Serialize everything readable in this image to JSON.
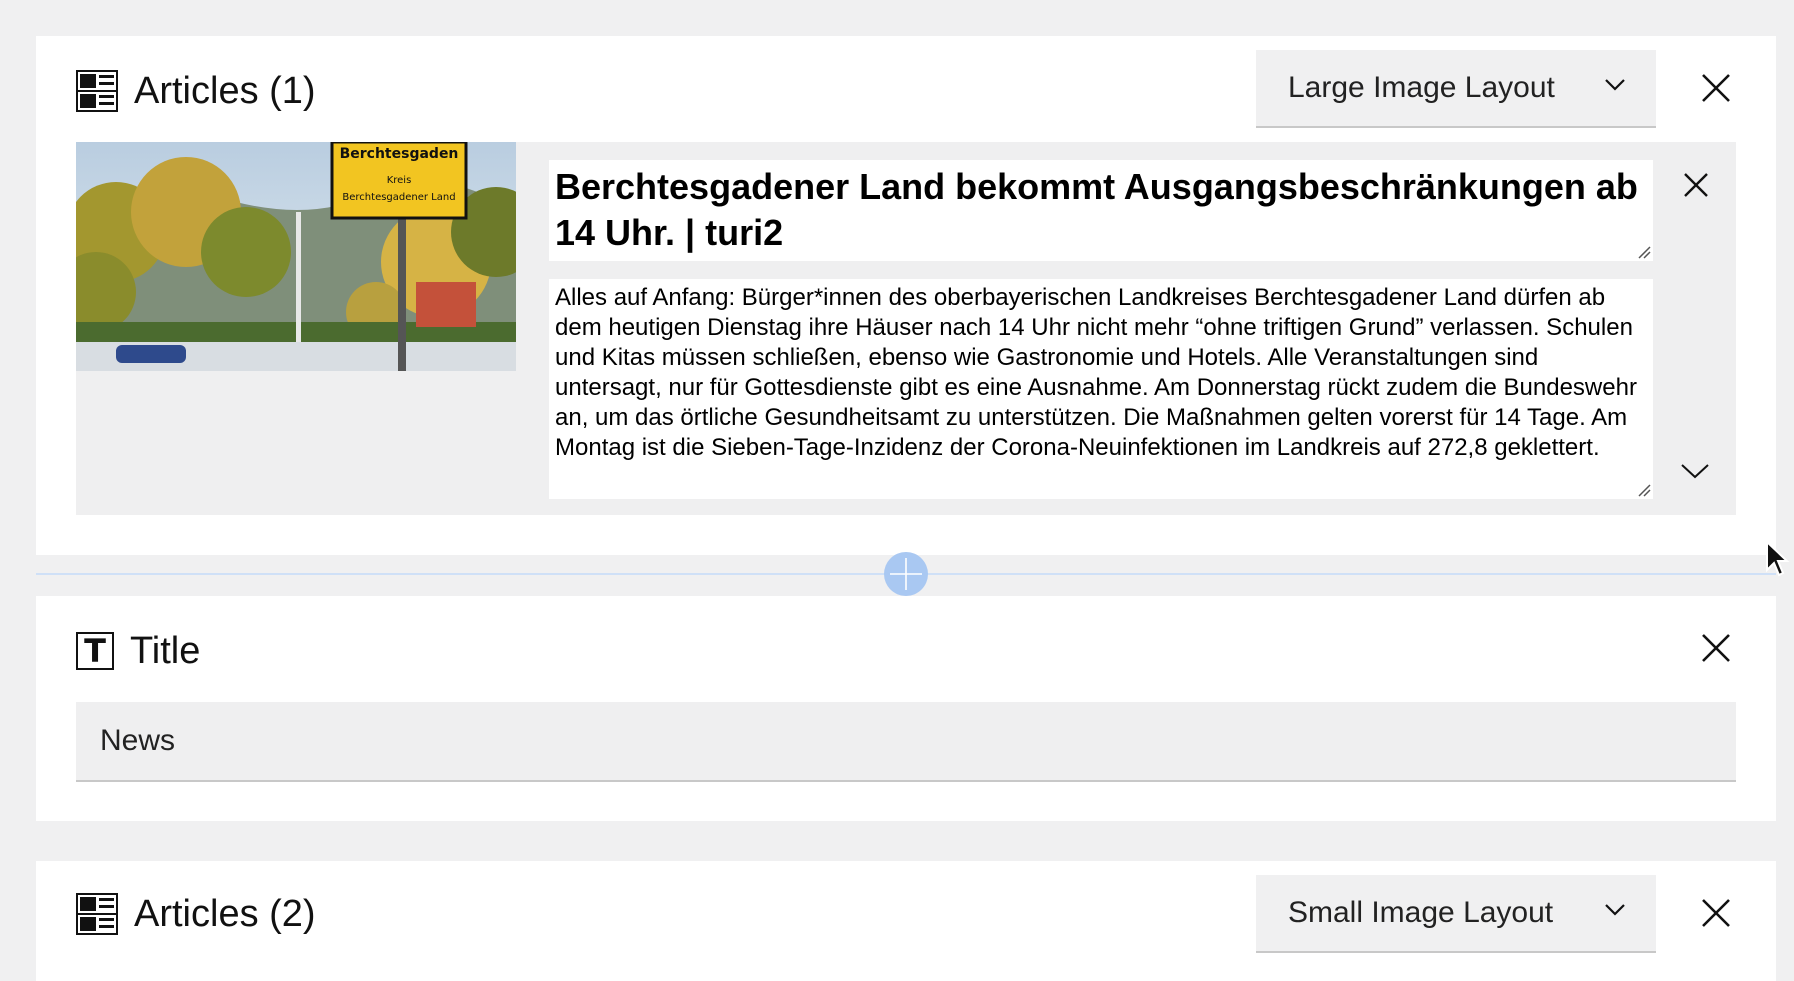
{
  "blocks": {
    "articles_1": {
      "title": "Articles (1)",
      "layout_value": "Large Image Layout",
      "article": {
        "image_sign_line1": "Berchtesgaden",
        "image_sign_line2": "Kreis",
        "image_sign_line3": "Berchtesgadener Land",
        "headline": "Berchtesgadener Land bekommt Ausgangsbeschränkungen ab 14 Uhr. | turi2",
        "body": "Alles auf Anfang: Bürger*innen des oberbayerischen Landkreises Berchtesgadener Land dürfen ab dem heutigen Dienstag ihre Häuser nach 14 Uhr nicht mehr “ohne triftigen Grund” verlassen. Schulen und Kitas müssen schließen, ebenso wie Gastronomie und Hotels. Alle Veranstaltungen sind untersagt, nur für Gottesdienste gibt es eine Ausnahme. Am Donnerstag rückt zudem die Bundeswehr an, um das örtliche Gesundheitsamt zu unterstützen. Die Maßnahmen gelten vorerst für 14 Tage. Am Montag ist die Sieben-Tage-Inzidenz der Corona-Neuinfektionen im Landkreis auf 272,8 geklettert."
      }
    },
    "title_block": {
      "title": "Title",
      "icon_letter": "T",
      "input_value": "News"
    },
    "articles_2": {
      "title": "Articles (2)",
      "layout_value": "Small Image Layout"
    }
  },
  "colors": {
    "page_bg": "#f0f0f1",
    "card_bg": "#ffffff",
    "field_bg": "#efeff0",
    "accent_add": "#a9c8f2",
    "divider": "#cfe0f7"
  },
  "icons": {
    "articles": "articles-layout-icon",
    "title": "title-t-icon",
    "close": "close-icon",
    "dropdown": "chevron-down-icon",
    "add": "plus-icon"
  }
}
